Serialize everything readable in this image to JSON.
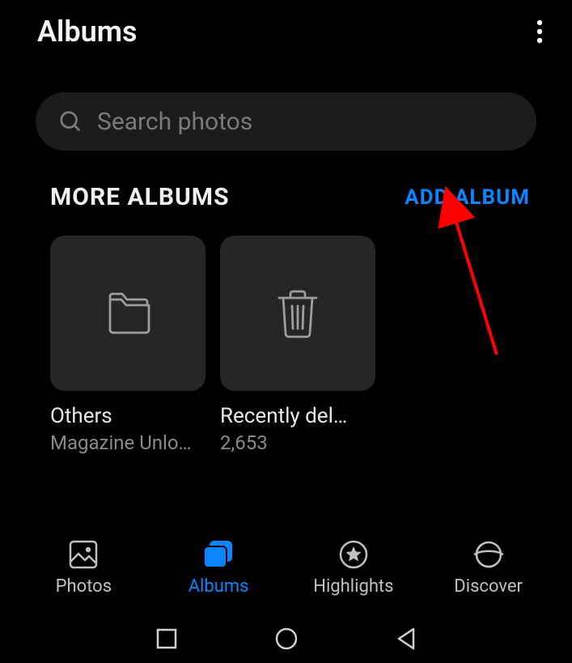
{
  "header": {
    "title": "Albums"
  },
  "search": {
    "placeholder": "Search photos"
  },
  "section": {
    "title": "MORE ALBUMS",
    "add_label": "ADD ALBUM"
  },
  "albums": [
    {
      "icon": "folder",
      "title": "Others",
      "sub": "Magazine Unlo…"
    },
    {
      "icon": "trash",
      "title": "Recently del…",
      "sub": "2,653"
    }
  ],
  "nav": {
    "photos": "Photos",
    "albums": "Albums",
    "highlights": "Highlights",
    "discover": "Discover"
  },
  "annotation": {
    "arrow_target": "add-album-button",
    "color": "#ff0000"
  }
}
